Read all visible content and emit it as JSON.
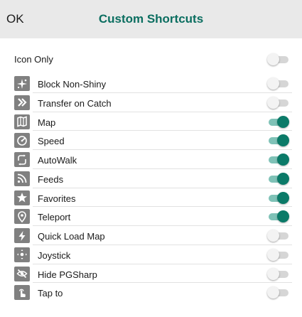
{
  "header": {
    "ok_label": "OK",
    "title": "Custom Shortcuts"
  },
  "colors": {
    "accent": "#0b7a68",
    "title": "#0b6e60",
    "header_bg": "#e9e9e9",
    "icon_bg": "#808080"
  },
  "icon_only": {
    "label": "Icon Only",
    "on": false
  },
  "items": [
    {
      "label": "Block Non-Shiny",
      "icon": "sparkle-icon",
      "on": false
    },
    {
      "label": "Transfer on Catch",
      "icon": "double-chevron-right-icon",
      "on": false
    },
    {
      "label": "Map",
      "icon": "map-icon",
      "on": true
    },
    {
      "label": "Speed",
      "icon": "speedometer-icon",
      "on": true
    },
    {
      "label": "AutoWalk",
      "icon": "loop-path-icon",
      "on": true
    },
    {
      "label": "Feeds",
      "icon": "rss-feed-icon",
      "on": true
    },
    {
      "label": "Favorites",
      "icon": "star-icon",
      "on": true
    },
    {
      "label": "Teleport",
      "icon": "location-pin-icon",
      "on": true
    },
    {
      "label": "Quick Load Map",
      "icon": "lightning-icon",
      "on": false
    },
    {
      "label": "Joystick",
      "icon": "joystick-icon",
      "on": false
    },
    {
      "label": "Hide PGSharp",
      "icon": "eye-off-icon",
      "on": false
    },
    {
      "label": "Tap to",
      "icon": "tap-hand-icon",
      "on": false
    }
  ]
}
